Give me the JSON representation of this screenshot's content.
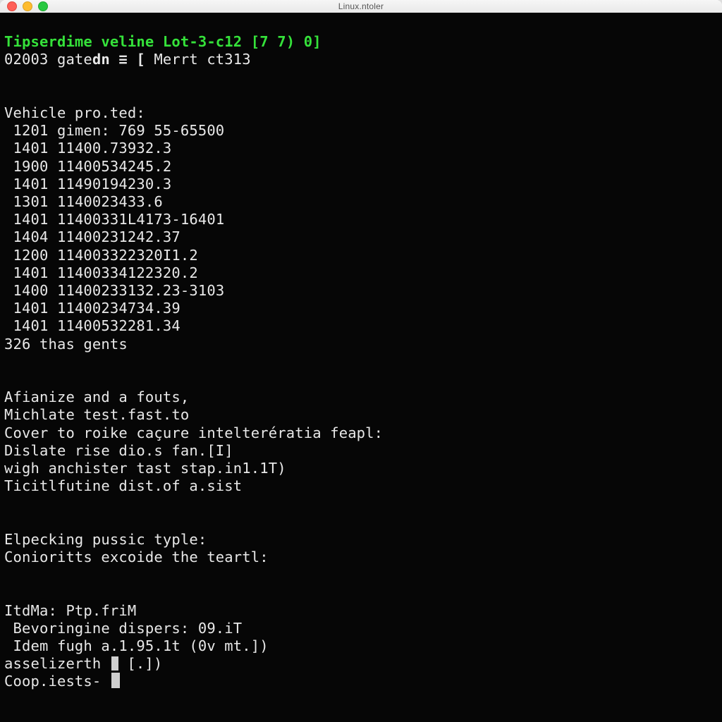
{
  "window": {
    "title": "Linux.ntoler"
  },
  "prompt1": {
    "line": "Tipserdime veline Lot-3-c12 [7 7) 0]"
  },
  "prompt2": {
    "pre": "02003 gate",
    "flag": "dn ≡ [",
    "post": " Merrt ct313"
  },
  "section_vehicle": {
    "header": "Vehicle pro.ted:"
  },
  "rows": [
    {
      "a": " 1201 gimen:",
      "b": " 769 55-65500"
    },
    {
      "a": " 1401",
      "b": " 11400.73932.3"
    },
    {
      "a": " 1900",
      "b": " 11400534245.2"
    },
    {
      "a": " 1401",
      "b": " 11490194230.3"
    },
    {
      "a": " 1301",
      "b": " 1140023433.6"
    },
    {
      "a": " 1401",
      "b": " 11400331L4173-16401"
    },
    {
      "a": " 1404",
      "b": " 11400231242.37"
    },
    {
      "a": " 1200",
      "b": " 114003322320I1.2"
    },
    {
      "a": " 1401",
      "b": " 11400334122320.2"
    },
    {
      "a": " 1400",
      "b": " 11400233132.23-3103"
    },
    {
      "a": " 1401",
      "b": " 11400234734.39"
    },
    {
      "a": " 1401",
      "b": " 11400532281.34"
    }
  ],
  "gents": {
    "line": "326 thas gents"
  },
  "mid": {
    "l1": "Afianize and a fouts,",
    "l2": "Michlate test.fast.to",
    "l3": "Cover to roike caçure intelterératia feapl:",
    "l4": "Dislate rise dio.s fan.[I]",
    "l5": "wigh anchister tast stap.in1.1T)",
    "l6": "Ticitlfutine dist.of a.sist"
  },
  "elp": {
    "l1": "Elpecking pussic typle:",
    "l2": "Conioritts excoide the teartl:"
  },
  "foot": {
    "l1": "ItdMa: Ptp.friM",
    "l2": " Bevoringine dispers: 09.iT",
    "l3": " Idem fugh a.1.95.1t (0v mt.])",
    "l4a": "asselizerth ",
    "l4b": " [.])",
    "prompt": "Coop.iests- "
  }
}
